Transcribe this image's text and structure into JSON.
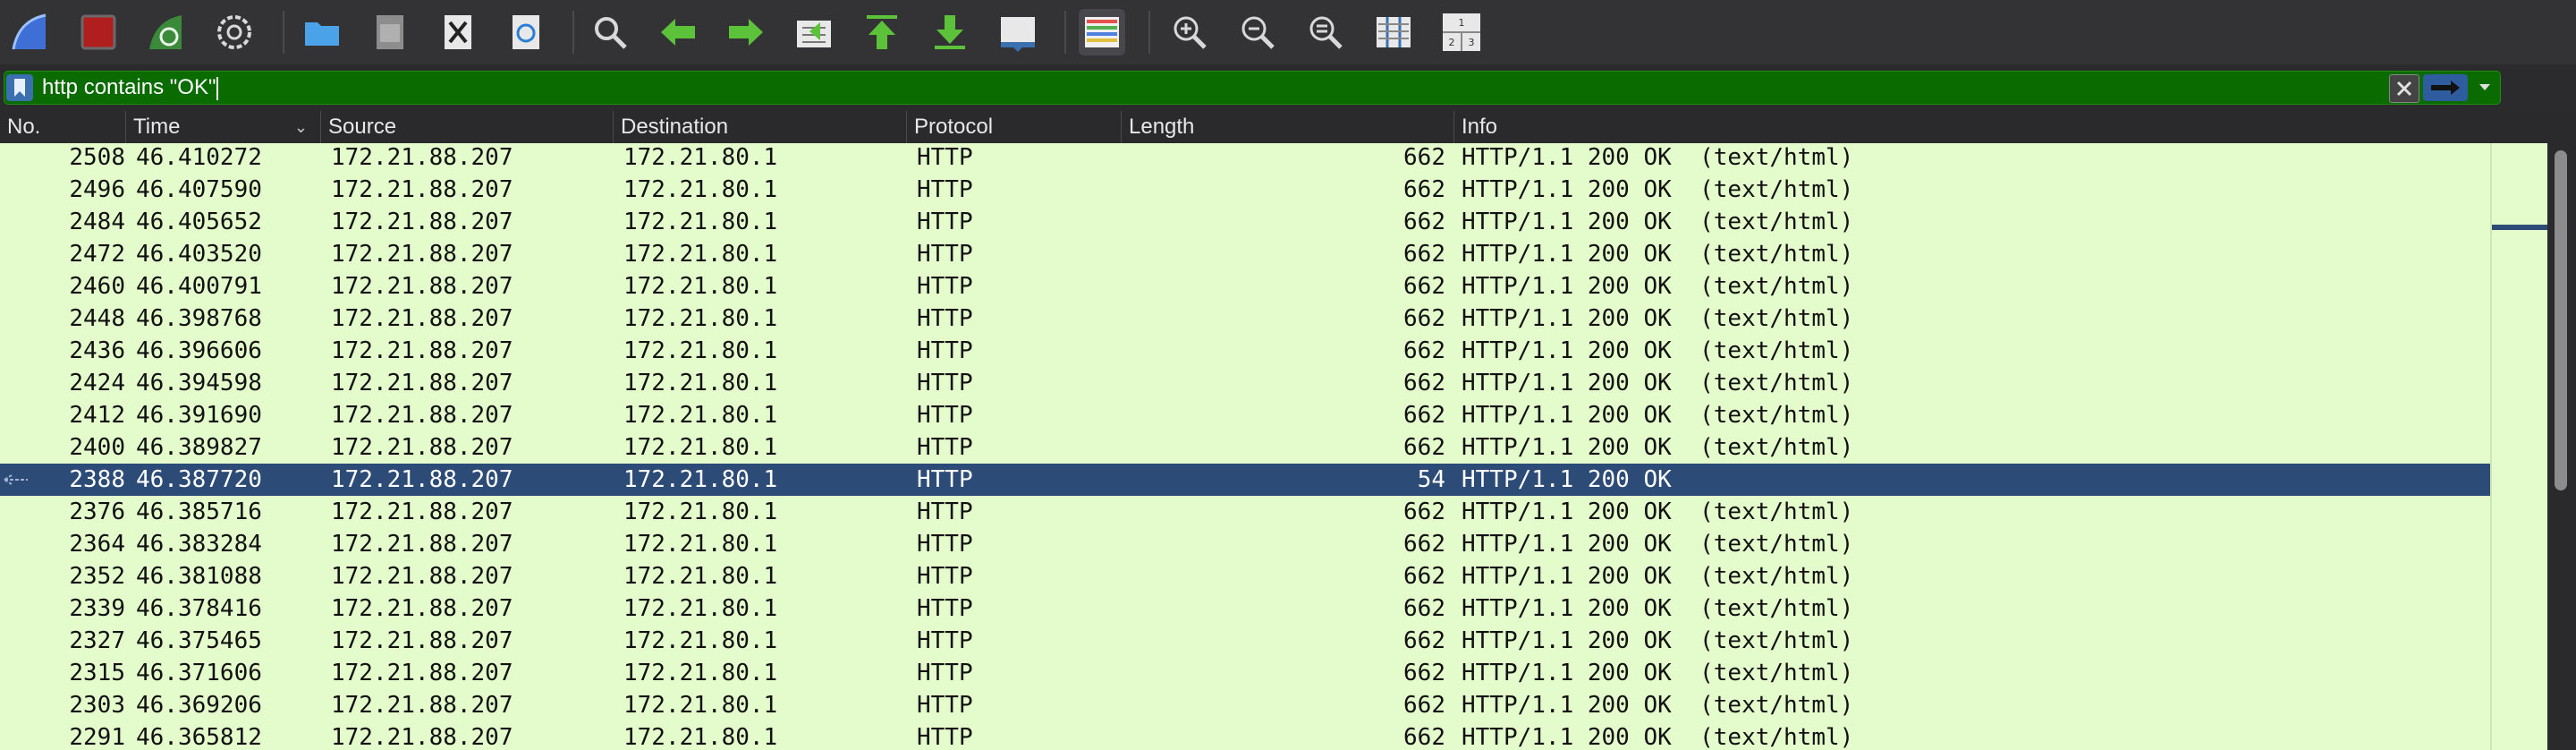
{
  "toolbar": {
    "icons": [
      "start-capture-icon",
      "stop-capture-icon",
      "restart-capture-icon",
      "capture-options-icon",
      "open-file-icon",
      "save-file-icon",
      "close-file-icon",
      "reload-file-icon",
      "find-packet-icon",
      "go-back-icon",
      "go-forward-icon",
      "go-to-packet-icon",
      "go-first-icon",
      "go-last-icon",
      "auto-scroll-icon",
      "colorize-icon",
      "zoom-in-icon",
      "zoom-out-icon",
      "normal-size-icon",
      "resize-columns-icon",
      "layout-icon"
    ]
  },
  "filter": {
    "value": "http contains \"OK\"",
    "color": "#0a6b00"
  },
  "columns": [
    "No.",
    "Time",
    "Source",
    "Destination",
    "Protocol",
    "Length",
    "Info"
  ],
  "rows": [
    {
      "no": "2508",
      "time": "46.410272",
      "src": "172.21.88.207",
      "dst": "172.21.80.1",
      "proto": "HTTP",
      "len": "662",
      "info": "HTTP/1.1 200 OK  (text/html)"
    },
    {
      "no": "2496",
      "time": "46.407590",
      "src": "172.21.88.207",
      "dst": "172.21.80.1",
      "proto": "HTTP",
      "len": "662",
      "info": "HTTP/1.1 200 OK  (text/html)"
    },
    {
      "no": "2484",
      "time": "46.405652",
      "src": "172.21.88.207",
      "dst": "172.21.80.1",
      "proto": "HTTP",
      "len": "662",
      "info": "HTTP/1.1 200 OK  (text/html)"
    },
    {
      "no": "2472",
      "time": "46.403520",
      "src": "172.21.88.207",
      "dst": "172.21.80.1",
      "proto": "HTTP",
      "len": "662",
      "info": "HTTP/1.1 200 OK  (text/html)"
    },
    {
      "no": "2460",
      "time": "46.400791",
      "src": "172.21.88.207",
      "dst": "172.21.80.1",
      "proto": "HTTP",
      "len": "662",
      "info": "HTTP/1.1 200 OK  (text/html)"
    },
    {
      "no": "2448",
      "time": "46.398768",
      "src": "172.21.88.207",
      "dst": "172.21.80.1",
      "proto": "HTTP",
      "len": "662",
      "info": "HTTP/1.1 200 OK  (text/html)"
    },
    {
      "no": "2436",
      "time": "46.396606",
      "src": "172.21.88.207",
      "dst": "172.21.80.1",
      "proto": "HTTP",
      "len": "662",
      "info": "HTTP/1.1 200 OK  (text/html)"
    },
    {
      "no": "2424",
      "time": "46.394598",
      "src": "172.21.88.207",
      "dst": "172.21.80.1",
      "proto": "HTTP",
      "len": "662",
      "info": "HTTP/1.1 200 OK  (text/html)"
    },
    {
      "no": "2412",
      "time": "46.391690",
      "src": "172.21.88.207",
      "dst": "172.21.80.1",
      "proto": "HTTP",
      "len": "662",
      "info": "HTTP/1.1 200 OK  (text/html)"
    },
    {
      "no": "2400",
      "time": "46.389827",
      "src": "172.21.88.207",
      "dst": "172.21.80.1",
      "proto": "HTTP",
      "len": "662",
      "info": "HTTP/1.1 200 OK  (text/html)"
    },
    {
      "no": "2388",
      "time": "46.387720",
      "src": "172.21.88.207",
      "dst": "172.21.80.1",
      "proto": "HTTP",
      "len": "54",
      "info": "HTTP/1.1 200 OK"
    },
    {
      "no": "2376",
      "time": "46.385716",
      "src": "172.21.88.207",
      "dst": "172.21.80.1",
      "proto": "HTTP",
      "len": "662",
      "info": "HTTP/1.1 200 OK  (text/html)"
    },
    {
      "no": "2364",
      "time": "46.383284",
      "src": "172.21.88.207",
      "dst": "172.21.80.1",
      "proto": "HTTP",
      "len": "662",
      "info": "HTTP/1.1 200 OK  (text/html)"
    },
    {
      "no": "2352",
      "time": "46.381088",
      "src": "172.21.88.207",
      "dst": "172.21.80.1",
      "proto": "HTTP",
      "len": "662",
      "info": "HTTP/1.1 200 OK  (text/html)"
    },
    {
      "no": "2339",
      "time": "46.378416",
      "src": "172.21.88.207",
      "dst": "172.21.80.1",
      "proto": "HTTP",
      "len": "662",
      "info": "HTTP/1.1 200 OK  (text/html)"
    },
    {
      "no": "2327",
      "time": "46.375465",
      "src": "172.21.88.207",
      "dst": "172.21.80.1",
      "proto": "HTTP",
      "len": "662",
      "info": "HTTP/1.1 200 OK  (text/html)"
    },
    {
      "no": "2315",
      "time": "46.371606",
      "src": "172.21.88.207",
      "dst": "172.21.80.1",
      "proto": "HTTP",
      "len": "662",
      "info": "HTTP/1.1 200 OK  (text/html)"
    },
    {
      "no": "2303",
      "time": "46.369206",
      "src": "172.21.88.207",
      "dst": "172.21.80.1",
      "proto": "HTTP",
      "len": "662",
      "info": "HTTP/1.1 200 OK  (text/html)"
    },
    {
      "no": "2291",
      "time": "46.365812",
      "src": "172.21.88.207",
      "dst": "172.21.80.1",
      "proto": "HTTP",
      "len": "662",
      "info": "HTTP/1.1 200 OK  (text/html)"
    }
  ],
  "selected_row": 10,
  "colors": {
    "row_bg": "#e4fbcb",
    "selected_bg": "#2d4b77",
    "filter_valid": "#0a6b00"
  }
}
